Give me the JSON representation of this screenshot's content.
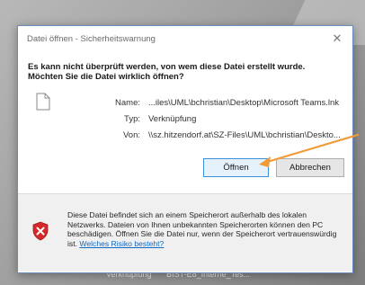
{
  "dialog": {
    "title": "Datei öffnen - Sicherheitswarnung",
    "headline_line1": "Es kann nicht überprüft werden, von wem diese Datei erstellt wurde.",
    "headline_line2": "Möchten Sie die Datei wirklich öffnen?",
    "fields": {
      "name_label": "Name:",
      "name_value": "...iles\\UML\\bchristian\\Desktop\\Microsoft Teams.lnk",
      "type_label": "Typ:",
      "type_value": "Verknüpfung",
      "from_label": "Von:",
      "from_value": "\\\\sz.hitzendorf.at\\SZ-Files\\UML\\bchristian\\Deskto..."
    },
    "buttons": {
      "open": "Öffnen",
      "cancel": "Abbrechen"
    },
    "warning": {
      "text": "Diese Datei befindet sich an einem Speicherort außerhalb des lokalen Netzwerks. Dateien von Ihnen unbekannten Speicherorten können den PC beschädigen. Öffnen Sie die Datei nur, wenn der Speicherort vertrauenswürdig ist.",
      "link": "Welches Risiko besteht?"
    }
  },
  "background": {
    "item_type": "Verknüpfung",
    "item_name": "BIST-E8_Interne_Tes..."
  },
  "icons": {
    "close": "close-icon",
    "file": "file-icon",
    "shield": "shield-warning-icon",
    "annotation_arrow": "arrow-annotation-icon"
  },
  "colors": {
    "accent": "#3c8fd8",
    "arrow": "#f39a38",
    "shield_red": "#d6282b",
    "link": "#0f6ac4"
  }
}
